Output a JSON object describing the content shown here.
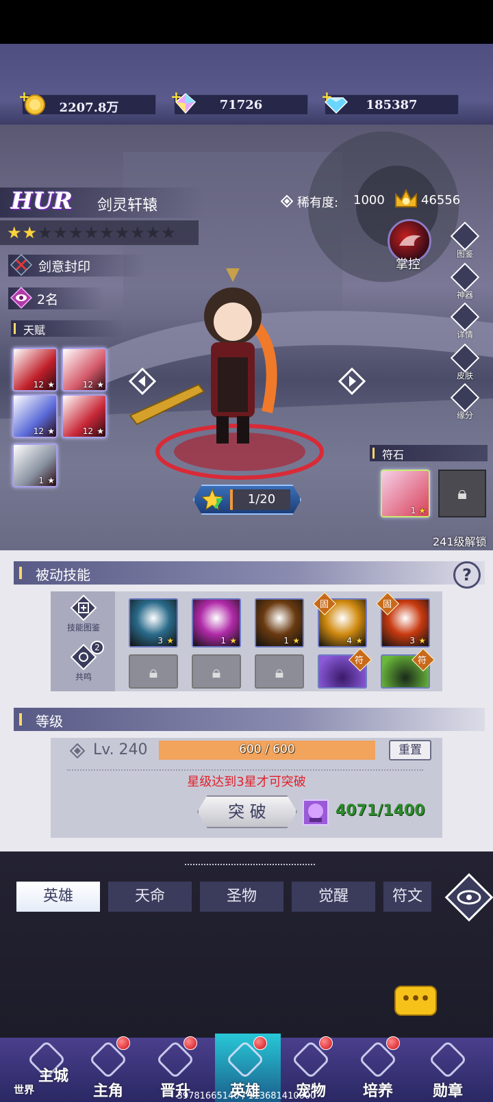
{
  "currencies": {
    "gold": "2207.8万",
    "gem_a": "71726",
    "gem_b": "185387"
  },
  "hero": {
    "rarity_tag": "HUR",
    "name": "剑灵轩辕",
    "rarity_label": "稀有度:",
    "rarity_value": "1000",
    "power": "46556",
    "stars_filled": 2,
    "stars_total": 11,
    "seal_label": "剑意封印",
    "rank_label": "2名",
    "control_label": "掌控",
    "level_progress": "1/20"
  },
  "talent": {
    "title": "天赋",
    "skills": [
      {
        "level": "12",
        "color": "#c0202a"
      },
      {
        "level": "12",
        "color": "#d55a6a"
      },
      {
        "level": "12",
        "color": "#5a6ad8"
      },
      {
        "level": "12",
        "color": "#c82838"
      },
      {
        "level": "1",
        "color": "#8890a0"
      }
    ]
  },
  "side_buttons": [
    "图鉴",
    "神器",
    "详情",
    "皮肤",
    "缘分"
  ],
  "runestone": {
    "title": "符石",
    "slot_level": "1",
    "unlock_text": "241级解锁"
  },
  "passive": {
    "title": "被动技能",
    "help": "?",
    "left_buttons": [
      "技能图鉴",
      "共鸣"
    ],
    "resonance_badge": "2",
    "skills_row1": [
      {
        "level": "3",
        "color": "#2a6a8a",
        "badge": ""
      },
      {
        "level": "1",
        "color": "#b02aa8",
        "badge": ""
      },
      {
        "level": "1",
        "color": "#6a3a10",
        "badge": ""
      },
      {
        "level": "4",
        "color": "#d08a10",
        "badge": "固"
      },
      {
        "level": "3",
        "color": "#c83a10",
        "badge": "固"
      }
    ],
    "skills_row2_badges": [
      "",
      "",
      "",
      "符",
      "符"
    ]
  },
  "level": {
    "title": "等级",
    "lv_text": "Lv. 240",
    "xp_text": "600 / 600",
    "xp_fraction": 1.0,
    "reset_label": "重置",
    "warning": "星级达到3星才可突破",
    "breakthrough_label": "突 破",
    "cost": "4071/1400"
  },
  "tabs": [
    "英雄",
    "天命",
    "圣物",
    "觉醒",
    "符文"
  ],
  "bottom_nav": [
    {
      "label": "主城",
      "sub": "世界"
    },
    {
      "label": "主角"
    },
    {
      "label": "晋升"
    },
    {
      "label": "英雄"
    },
    {
      "label": "宠物"
    },
    {
      "label": "培养"
    },
    {
      "label": "勋章"
    }
  ],
  "footer_id": "39781665140 / 113681410000",
  "colors": {
    "accent_gold": "#ffd86a",
    "xp_bar": "#f2a35c",
    "warning_red": "#e0202a",
    "cost_green": "#2c8c2c"
  }
}
